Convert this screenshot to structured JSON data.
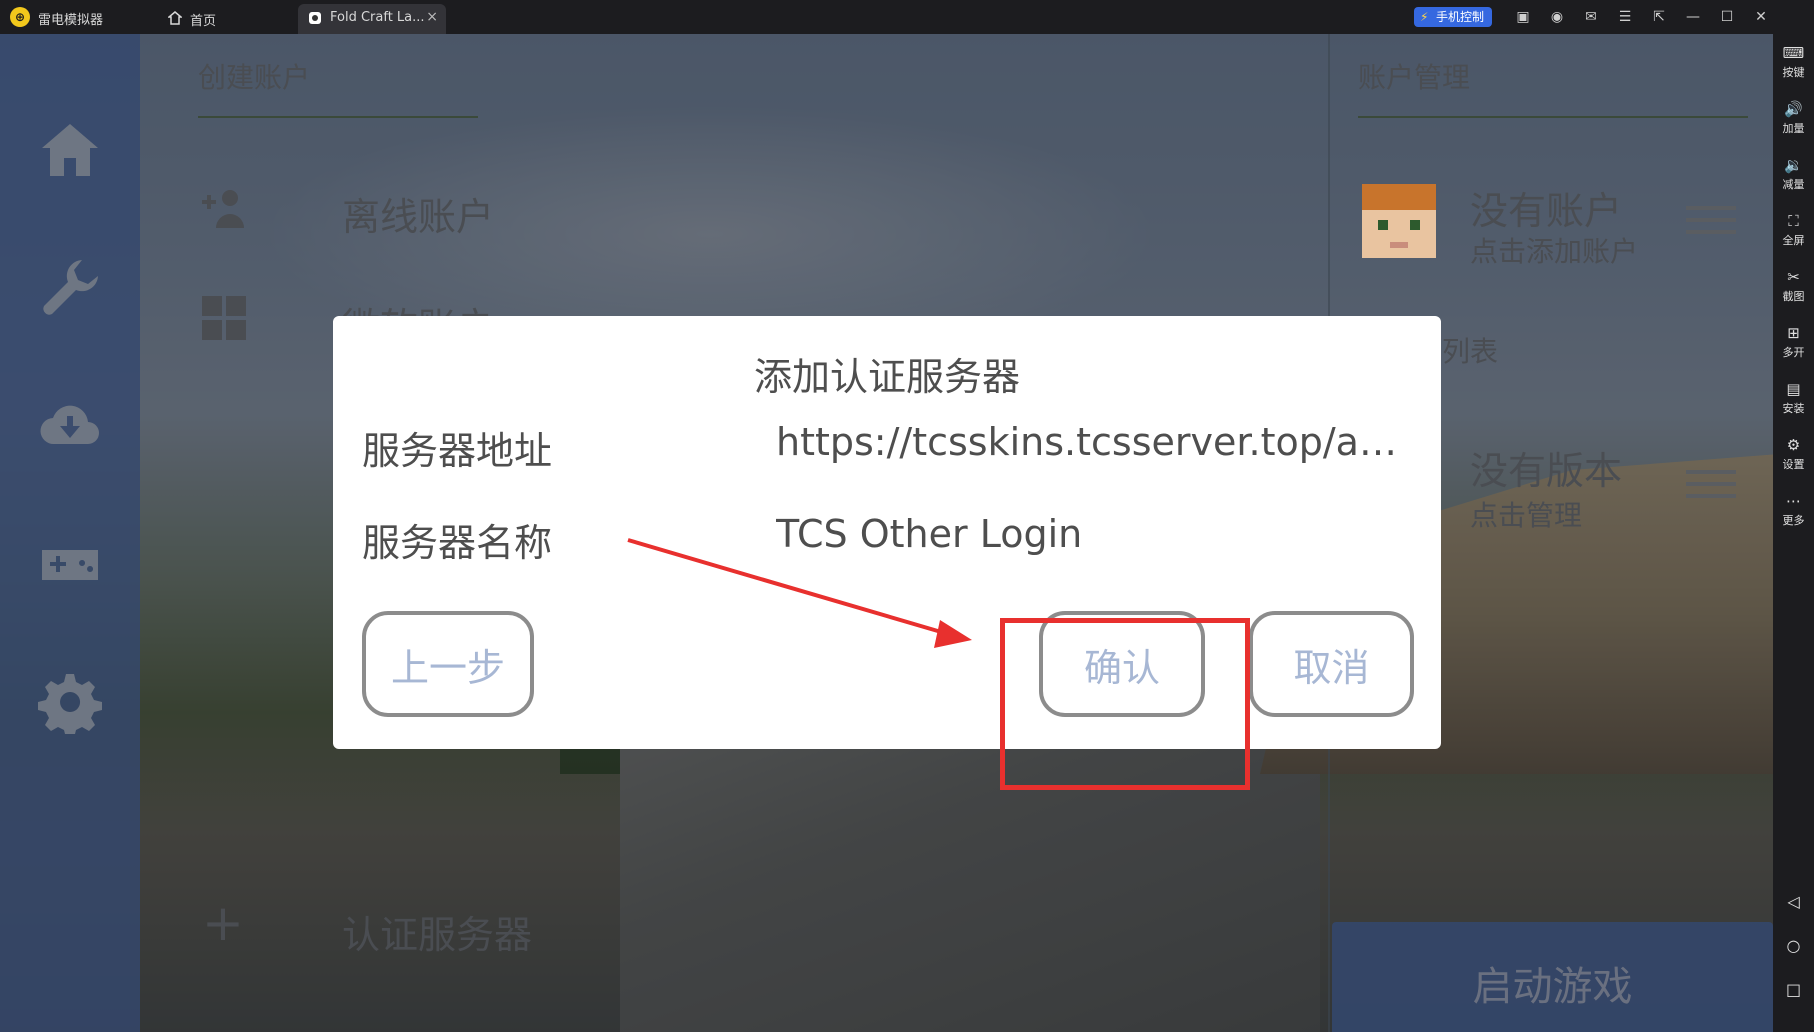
{
  "titlebar": {
    "app_name": "雷电模拟器",
    "logo_char": "⊕",
    "tabs": [
      {
        "label": "首页",
        "icon": "home-icon"
      },
      {
        "label": "Fold Craft La...",
        "icon": "app-icon",
        "close": "×"
      }
    ],
    "phone_control": "手机控制",
    "window_icons": [
      "gamepad-icon",
      "user-icon",
      "mail-icon",
      "menu-icon",
      "export-icon",
      "minimize-icon",
      "maximize-icon",
      "close-icon"
    ]
  },
  "rightbar": {
    "items": [
      {
        "label": "按键",
        "icon": "keyboard-icon"
      },
      {
        "label": "加量",
        "icon": "volume-up-icon"
      },
      {
        "label": "减量",
        "icon": "volume-down-icon"
      },
      {
        "label": "全屏",
        "icon": "fullscreen-icon"
      },
      {
        "label": "截图",
        "icon": "scissors-icon"
      },
      {
        "label": "多开",
        "icon": "multi-instance-icon"
      },
      {
        "label": "安装",
        "icon": "apk-install-icon"
      },
      {
        "label": "设置",
        "icon": "settings-icon"
      },
      {
        "label": "更多",
        "icon": "more-icon"
      }
    ],
    "nav": [
      "back-icon",
      "home-circle-icon",
      "recents-icon"
    ]
  },
  "app": {
    "nav": [
      "home-icon",
      "wrench-icon",
      "download-icon",
      "gamepad-icon",
      "gear-icon"
    ],
    "create_account": {
      "title": "创建账户",
      "offline": "离线账户",
      "microsoft": "微软账户",
      "auth_server": "认证服务器",
      "plus": "+"
    },
    "account_manage": {
      "title": "账户管理",
      "no_account": "没有账户",
      "click_add": "点击添加账户",
      "version_list_fragment": "列表",
      "no_version": "没有版本",
      "click_manage": "点击管理",
      "launch": "启动游戏"
    }
  },
  "dialog": {
    "title": "添加认证服务器",
    "address_label": "服务器地址",
    "address_value": "https://tcsskins.tcsserver.top/api/yggdrasil",
    "name_label": "服务器名称",
    "name_value": "TCS Other Login",
    "prev_button": "上一步",
    "confirm_button": "确认",
    "cancel_button": "取消"
  },
  "colors": {
    "annotation": "#e8302e",
    "button_text": "#a7b7d4",
    "nav_rail": "#34486e",
    "phone_control": "#3568e0"
  }
}
